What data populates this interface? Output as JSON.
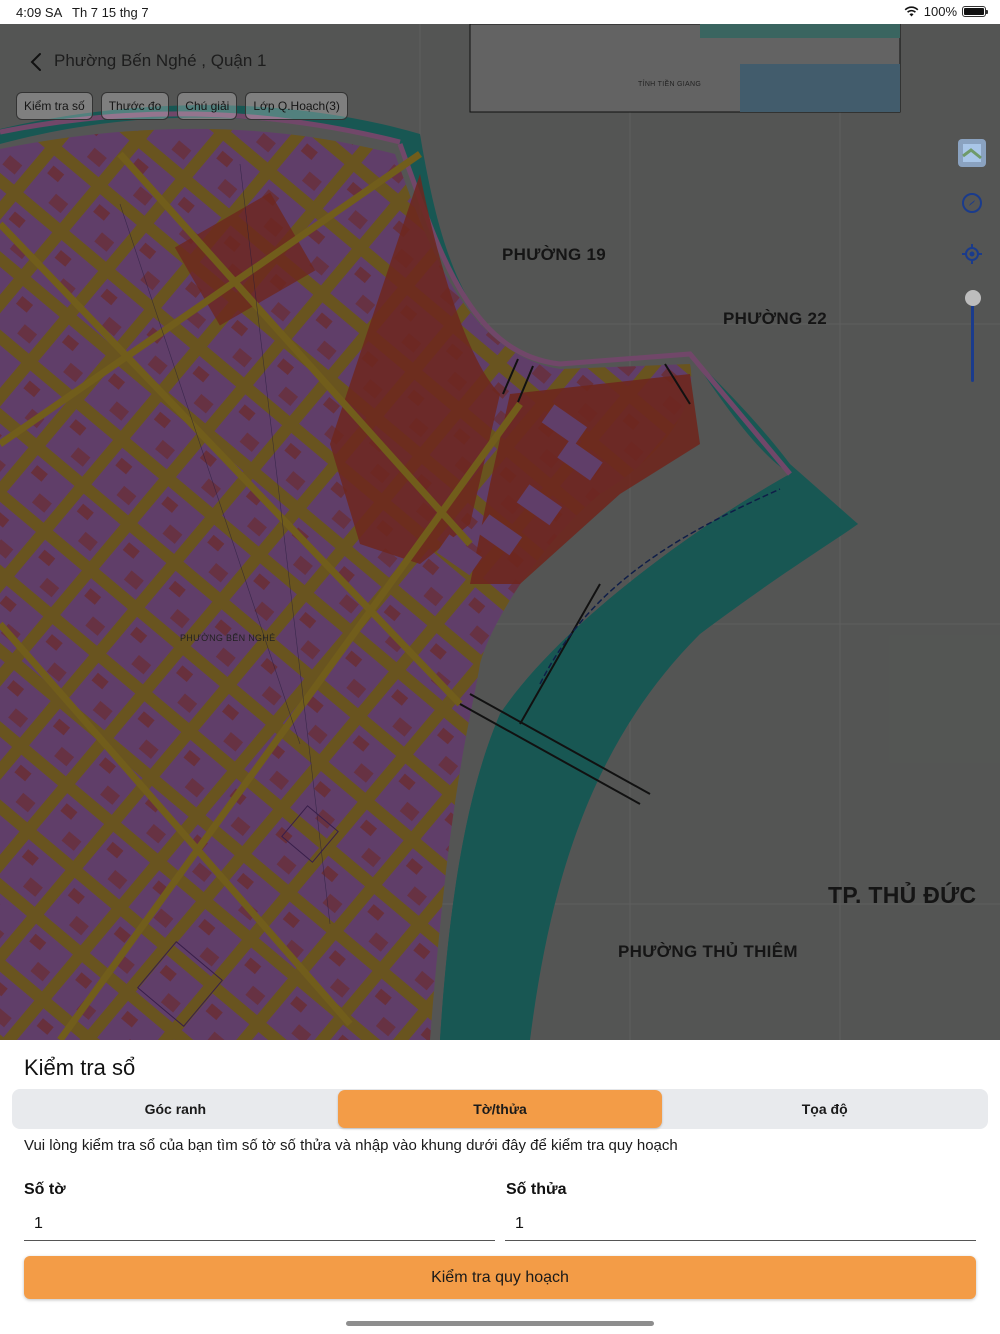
{
  "status_bar": {
    "time": "4:09 SA",
    "date": "Th 7 15 thg 7",
    "battery": "100%",
    "icons": [
      "wifi-icon",
      "battery-icon"
    ]
  },
  "header": {
    "title": "Phường Bến Nghé , Quận 1",
    "back_icon": "chevron-left-icon"
  },
  "map": {
    "chips": [
      "Kiểm tra số",
      "Thước đo",
      "Chú giải",
      "Lớp Q.Hoạch(3)"
    ],
    "labels": {
      "phuong19": "PHƯỜNG 19",
      "phuong22": "PHƯỜNG 22",
      "tpthuduc": "TP. THỦ ĐỨC",
      "thuthiem": "PHƯỜNG THỦ THIÊM",
      "benghe": "PHƯỜNG BẾN NGHÉ",
      "tiengiang": "TỈNH TIỀN GIANG"
    },
    "controls": [
      "layers-icon",
      "compass-icon",
      "locate-icon"
    ]
  },
  "sheet": {
    "title": "Kiểm tra sổ",
    "tabs": [
      {
        "label": "Góc ranh",
        "active": false
      },
      {
        "label": "Tờ/thửa",
        "active": true
      },
      {
        "label": "Tọa độ",
        "active": false
      }
    ],
    "description": "Vui lòng kiểm tra sổ của bạn tìm số tờ số thửa và nhập vào khung dưới đây để kiểm tra quy hoạch",
    "so_to": {
      "label": "Số tờ",
      "value": "1"
    },
    "so_thua": {
      "label": "Số thửa",
      "value": "1"
    },
    "submit_label": "Kiểm tra quy hoạch"
  },
  "colors": {
    "accent": "#f39c47",
    "segment_bg": "#e8eaed",
    "river": "#2fa8a0",
    "land": "#c9a23c",
    "zone_red": "#d24a3a"
  }
}
